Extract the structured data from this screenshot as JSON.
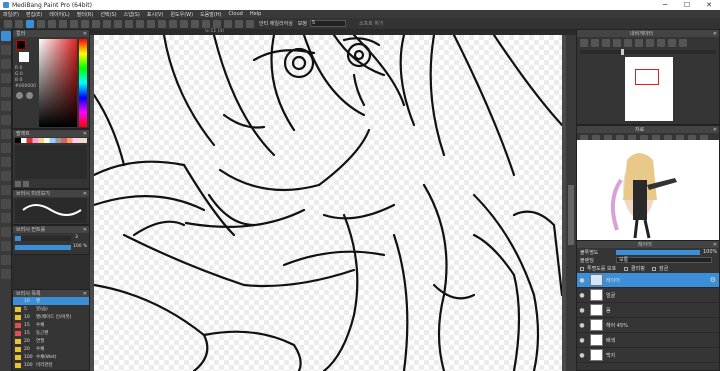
{
  "app": {
    "title": "MediBang Paint Pro (64bit)",
    "controls": [
      "─",
      "☐",
      "✕"
    ]
  },
  "menu": [
    "파일(F)",
    "편집(E)",
    "레이어(L)",
    "필터(R)",
    "선택(S)",
    "스냅(S)",
    "표시(V)",
    "윈도우(W)",
    "도움말(H)",
    "Cloud",
    "Help"
  ],
  "toolbar": {
    "antialias_label": "안티 에일리어싱",
    "correction_label": "보정",
    "correction_value": "5",
    "soft_label": "소프트 하기"
  },
  "tab": {
    "label": "\\s-11 (4)"
  },
  "panels": {
    "color": {
      "title": "컬러",
      "values": [
        "R 0",
        "G 0",
        "B 0",
        "#000000"
      ]
    },
    "palette": {
      "title": "팔레트"
    },
    "brush_preview": {
      "title": "브러시 미리보기"
    },
    "brush_control": {
      "title": "브러시 컨트롤",
      "size": "3",
      "opacity": "100 %"
    },
    "brush_list": {
      "title": "브러시 목록",
      "items": [
        {
          "num": "10",
          "name": "펜",
          "color": "#3c8fd6",
          "selected": true
        },
        {
          "num": "5",
          "name": "붓(습)",
          "color": "#e8c233"
        },
        {
          "num": "10",
          "name": "펜(페이드 인/아웃)",
          "color": "#e8c233"
        },
        {
          "num": "15",
          "name": "수채",
          "color": "#e05050"
        },
        {
          "num": "15",
          "name": "둥근펜",
          "color": "#e05050"
        },
        {
          "num": "20",
          "name": "연필",
          "color": "#e8c233"
        },
        {
          "num": "20",
          "name": "수채",
          "color": "#e8c233"
        },
        {
          "num": "100",
          "name": "수채(Wet)",
          "color": "#e8c233"
        },
        {
          "num": "100",
          "name": "미러관련",
          "color": "#e8c233"
        }
      ]
    },
    "navigator": {
      "title": "내비게이터"
    },
    "material": {
      "title": "자료"
    },
    "layer": {
      "title": "레이어",
      "opacity_label": "불투명도",
      "opacity_value": "100%",
      "blend_label": "블렌딩",
      "blend_value": "보통",
      "protect_label": "투명도를 보호",
      "clipping_label": "클리핑",
      "lock_label": "잠금",
      "layers": [
        {
          "name": "레이어",
          "selected": true
        },
        {
          "name": "얼굴"
        },
        {
          "name": "몸"
        },
        {
          "name": "헤어 45%"
        },
        {
          "name": "배색"
        },
        {
          "name": "백지"
        }
      ]
    }
  },
  "colors": {
    "accent": "#3c8fd6",
    "panel": "#353535",
    "header": "#444444"
  }
}
